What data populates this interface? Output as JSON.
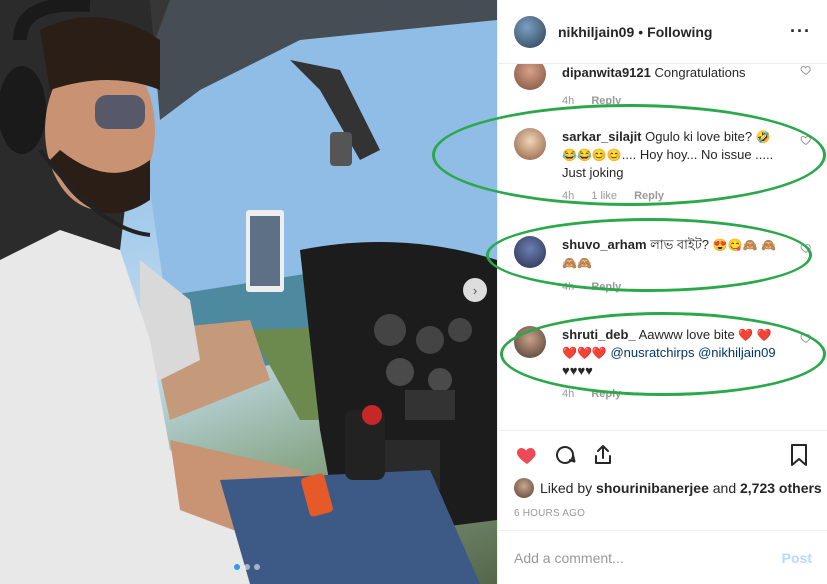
{
  "header": {
    "username": "nikhiljain09",
    "separator": "•",
    "follow_status": "Following",
    "more_icon": "more-horizontal-icon"
  },
  "comments": [
    {
      "username": "dipanwita9121",
      "text": "Congratulations",
      "time": "4h",
      "likes": "",
      "reply": "Reply"
    },
    {
      "username": "sarkar_silajit",
      "text": "Ogulo ki love bite?",
      "emoji": "🤣😂😂😊😊",
      "text2": ".... Hoy hoy... No issue ..... Just joking",
      "time": "4h",
      "likes": "1 like",
      "reply": "Reply"
    },
    {
      "username": "shuvo_arham",
      "text": "লাভ বাইট?",
      "emoji": "😍😋🙈",
      "emoji2": "🙈🙈🙈",
      "time": "4h",
      "likes": "",
      "reply": "Reply"
    },
    {
      "username": "shruti_deb_",
      "text": "Aawww love bite",
      "hearts": "❤️",
      "hearts2": "❤️❤️❤️❤️",
      "mention1": "@nusratchirps",
      "mention2": "@nikhiljain09",
      "black_hearts": "♥♥♥♥",
      "time": "4h",
      "likes": "",
      "reply": "Reply"
    }
  ],
  "actions": {
    "like_icon": "heart-filled-icon",
    "comment_icon": "comment-icon",
    "share_icon": "share-icon",
    "save_icon": "bookmark-icon",
    "like_color": "#ed4956"
  },
  "likes": {
    "prefix": "Liked by",
    "user": "shourinibanerjee",
    "middle": "and",
    "count": "2,723 others"
  },
  "timestamp": "6 HOURS AGO",
  "add_comment": {
    "placeholder": "Add a comment...",
    "post_label": "Post"
  },
  "colors": {
    "highlight_ring": "#2aa84a",
    "post_disabled": "#b3dbff",
    "accent": "#3897f0"
  }
}
